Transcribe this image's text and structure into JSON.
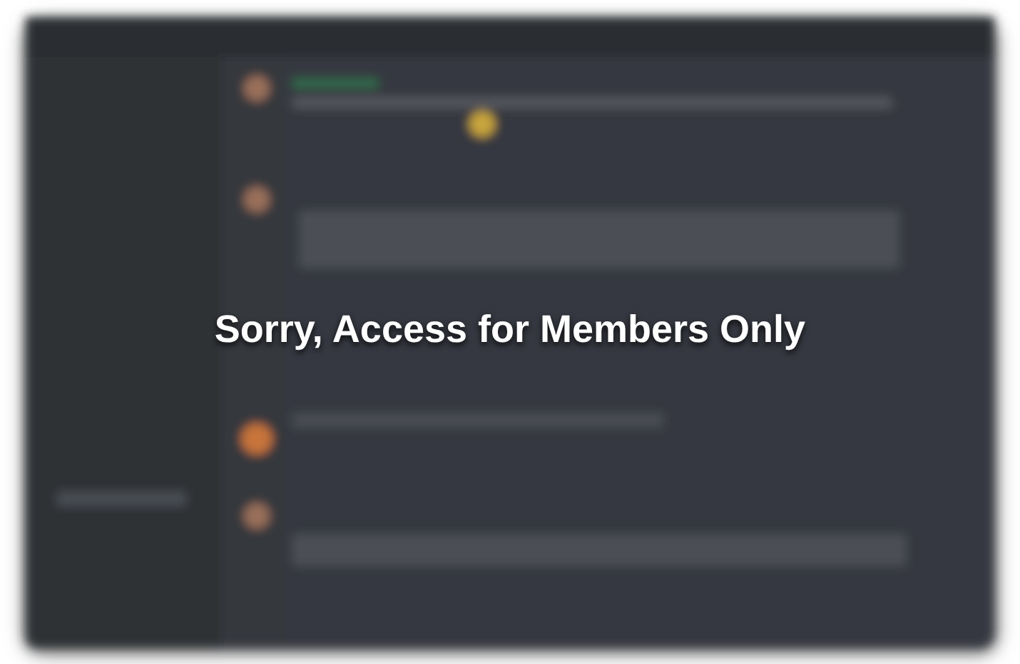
{
  "notice": {
    "text": "Sorry, Access for Members Only"
  }
}
